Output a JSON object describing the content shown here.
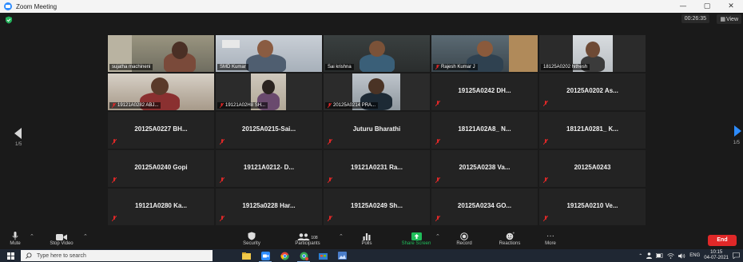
{
  "window": {
    "title": "Zoom Meeting",
    "controls": [
      "—",
      "▢",
      "✕"
    ]
  },
  "meeting": {
    "elapsed": "00:26:35",
    "view_label": "View"
  },
  "pagination": {
    "left": "1/5",
    "right": "1/5"
  },
  "tiles": [
    {
      "label": "sujatha machineni",
      "type": "video",
      "muted": false,
      "active": true
    },
    {
      "label": "SMD Kumar",
      "type": "video",
      "muted": false
    },
    {
      "label": "Sai krishna",
      "type": "video",
      "muted": false
    },
    {
      "label": "Rajesh Kumar J",
      "type": "video",
      "muted": true
    },
    {
      "label": "18125A0202 hithesh",
      "type": "video",
      "muted": false
    },
    {
      "label": "19121A0282 ABJ...",
      "type": "video",
      "muted": true
    },
    {
      "label": "19121A02H8 SH...",
      "type": "video",
      "muted": true
    },
    {
      "label": "20125A0214 PRA...",
      "type": "video",
      "muted": true
    },
    {
      "label": "19125A0242 DH...",
      "type": "name",
      "muted": true
    },
    {
      "label": "20125A0202 As...",
      "type": "name",
      "muted": true
    },
    {
      "label": "20125A0227 BH...",
      "type": "name",
      "muted": true
    },
    {
      "label": "20125A0215-Sai...",
      "type": "name",
      "muted": true
    },
    {
      "label": "Juturu Bharathi",
      "type": "name",
      "muted": true
    },
    {
      "label": "18121A02A8_ N...",
      "type": "name",
      "muted": true
    },
    {
      "label": "18121A0281_ K...",
      "type": "name",
      "muted": true
    },
    {
      "label": "20125A0240 Gopi",
      "type": "name",
      "muted": true
    },
    {
      "label": "19121A0212- D...",
      "type": "name",
      "muted": true
    },
    {
      "label": "19121A0231 Ra...",
      "type": "name",
      "muted": true
    },
    {
      "label": "20125A0238 Va...",
      "type": "name",
      "muted": true
    },
    {
      "label": "20125A0243",
      "type": "name",
      "muted": true
    },
    {
      "label": "19121A0280 Ka...",
      "type": "name",
      "muted": true
    },
    {
      "label": "19125a0228 Har...",
      "type": "name",
      "muted": true
    },
    {
      "label": "19125A0249 Sh...",
      "type": "name",
      "muted": true
    },
    {
      "label": "20125A0234 GO...",
      "type": "name",
      "muted": true
    },
    {
      "label": "19125A0210 Ve...",
      "type": "name",
      "muted": true
    }
  ],
  "toolbar": {
    "mute": "Mute",
    "stop_video": "Stop Video",
    "security": "Security",
    "participants": "Participants",
    "participants_count": "108",
    "polls": "Polls",
    "share_screen": "Share Screen",
    "record": "Record",
    "reactions": "Reactions",
    "more": "More",
    "more_icon": "···",
    "end": "End"
  },
  "taskbar": {
    "search_placeholder": "Type here to search",
    "language": "ENG",
    "time": "10:15",
    "date": "04-07-2021"
  },
  "colors": {
    "accent": "#2d8cff",
    "end": "#e02828",
    "share": "#1fbd5a",
    "muted": "#e02828",
    "active_speaker": "#cfe34a"
  }
}
